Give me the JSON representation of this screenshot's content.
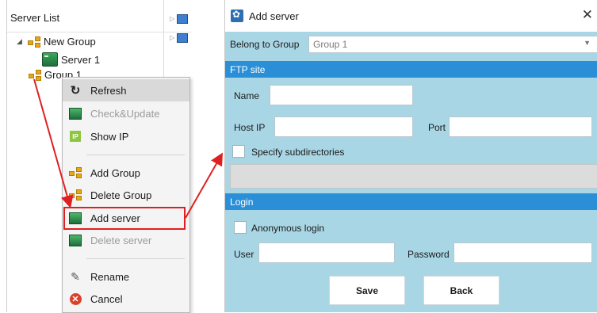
{
  "server_list": {
    "title": "Server List",
    "tree": [
      {
        "label": "New Group"
      },
      {
        "label": "Server 1"
      },
      {
        "label": "Group 1"
      }
    ]
  },
  "context_menu": {
    "items": [
      {
        "label": "Refresh",
        "icon": "refresh-icon",
        "highlighted": true
      },
      {
        "label": "Check&Update",
        "icon": "server-icon",
        "disabled": true
      },
      {
        "label": "Show IP",
        "icon": "ip-icon"
      },
      {
        "label": "Add Group",
        "icon": "group-icon"
      },
      {
        "label": "Delete Group",
        "icon": "group-icon"
      },
      {
        "label": "Add server",
        "icon": "server-icon"
      },
      {
        "label": "Delete server",
        "icon": "server-icon",
        "disabled": true
      },
      {
        "label": "Rename",
        "icon": "pencil-icon"
      },
      {
        "label": "Cancel",
        "icon": "cancel-icon"
      }
    ]
  },
  "dialog": {
    "title": "Add server",
    "belong_label": "Belong to Group",
    "belong_value": "Group 1",
    "ftp_section": "FTP site",
    "name_label": "Name",
    "name_value": "",
    "host_label": "Host IP",
    "host_value": "",
    "port_label": "Port",
    "port_value": "",
    "subdir_label": "Specify subdirectories",
    "login_section": "Login",
    "anon_label": "Anonymous login",
    "user_label": "User",
    "user_value": "",
    "password_label": "Password",
    "password_value": "",
    "save_label": "Save",
    "back_label": "Back"
  },
  "colors": {
    "accent": "#2a8fd6",
    "panel_bg": "#a9d6e5",
    "highlight_red": "#e02020"
  }
}
